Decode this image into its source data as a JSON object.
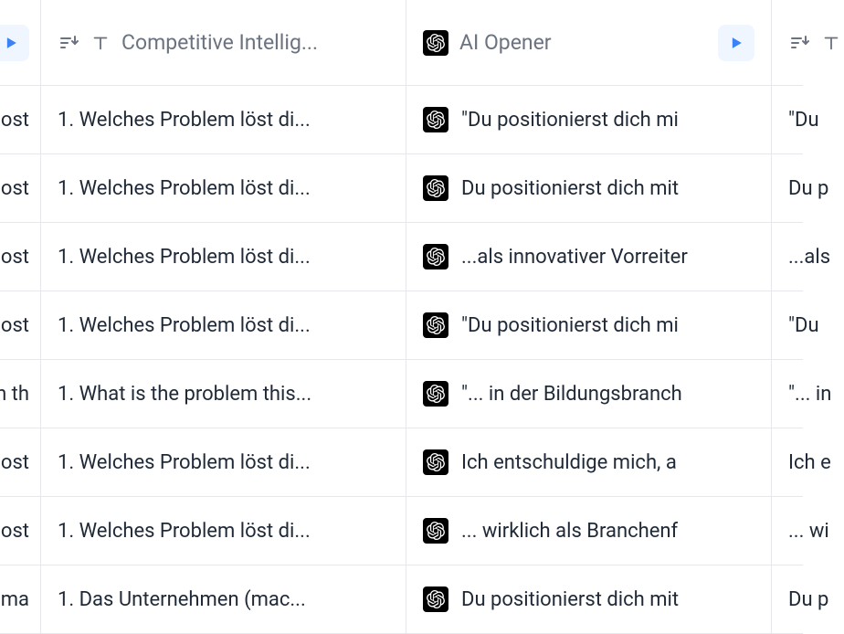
{
  "columns": {
    "col1": {
      "header": "Competitive Intellig..."
    },
    "col2": {
      "header": "AI Opener"
    }
  },
  "rows": [
    {
      "c0": "ost",
      "c1": "1. Welches Problem löst di...",
      "c2": "\"Du positionierst dich mi",
      "c3": "\"Du"
    },
    {
      "c0": "ost",
      "c1": "1. Welches Problem löst di...",
      "c2": "Du positionierst dich mit",
      "c3": "Du p"
    },
    {
      "c0": "ost",
      "c1": "1. Welches Problem löst di...",
      "c2": "...als innovativer Vorreiter",
      "c3": "...als"
    },
    {
      "c0": "ost",
      "c1": "1. Welches Problem löst di...",
      "c2": "\"Du positionierst dich mi",
      "c3": "\"Du"
    },
    {
      "c0": "n th",
      "c1": "1. What is the problem this...",
      "c2": "\"... in der Bildungsbranch",
      "c3": "\"... in"
    },
    {
      "c0": "ost",
      "c1": "1. Welches Problem löst di...",
      "c2": "Ich entschuldige mich, a",
      "c3": "Ich e"
    },
    {
      "c0": "ost",
      "c1": "1. Welches Problem löst di...",
      "c2": "... wirklich als Branchenf",
      "c3": "... wi"
    },
    {
      "c0": "ma",
      "c1": "1. Das Unternehmen (mac...",
      "c2": "Du positionierst dich mit",
      "c3": "Du p"
    }
  ]
}
